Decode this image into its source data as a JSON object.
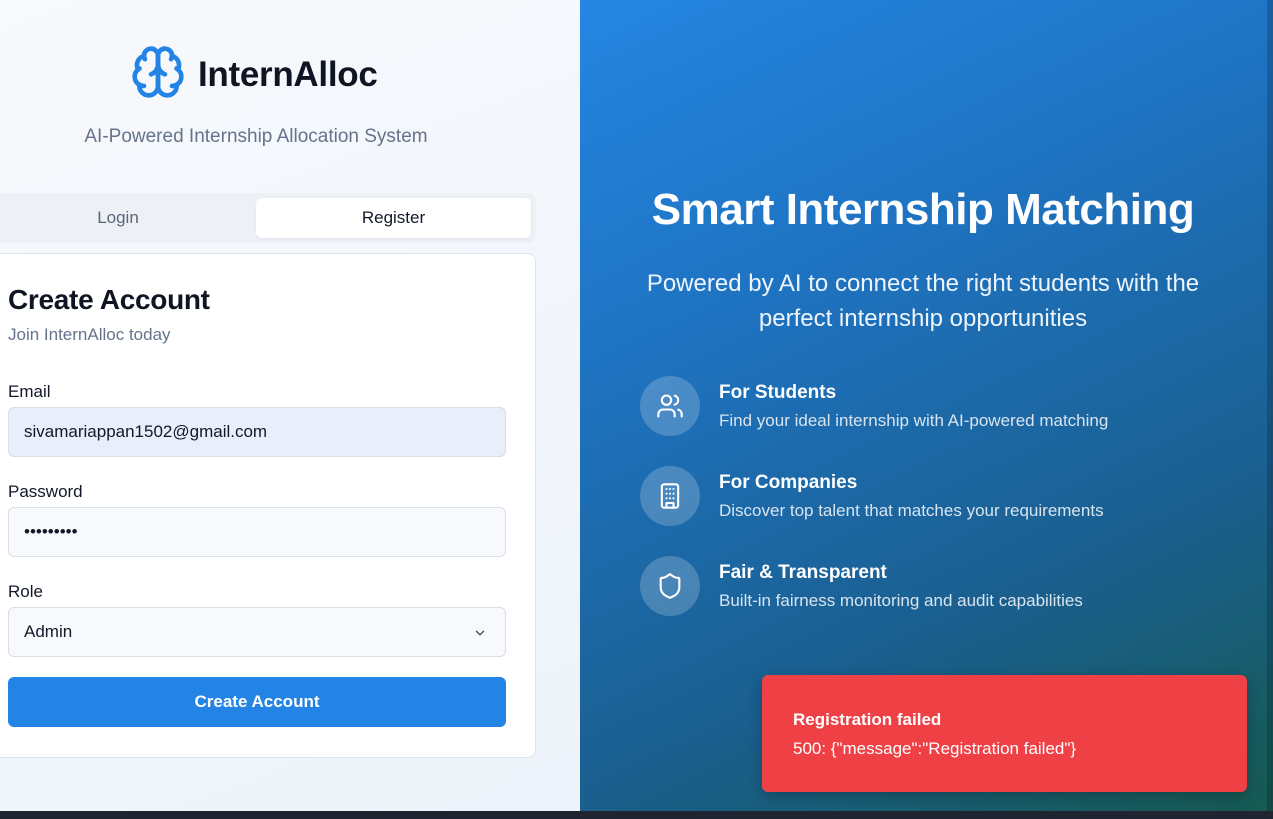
{
  "brand": {
    "name": "InternAlloc",
    "icon": "brain-icon",
    "subtitle": "AI-Powered Internship Allocation System"
  },
  "tabs": [
    {
      "label": "Login",
      "active": false
    },
    {
      "label": "Register",
      "active": true
    }
  ],
  "form": {
    "title": "Create Account",
    "subtitle": "Join InternAlloc today",
    "email": {
      "label": "Email",
      "value": "sivamariappan1502@gmail.com"
    },
    "password": {
      "label": "Password",
      "value": "•••••••••"
    },
    "role": {
      "label": "Role",
      "value": "Admin"
    },
    "submit_label": "Create Account"
  },
  "hero": {
    "title": "Smart Internship Matching",
    "subtitle": "Powered by AI to connect the right students with the perfect internship opportunities",
    "features": [
      {
        "icon": "users-icon",
        "title": "For Students",
        "desc": "Find your ideal internship with AI-powered matching"
      },
      {
        "icon": "building-icon",
        "title": "For Companies",
        "desc": "Discover top talent that matches your requirements"
      },
      {
        "icon": "shield-icon",
        "title": "Fair & Transparent",
        "desc": "Built-in fairness monitoring and audit capabilities"
      }
    ]
  },
  "toast": {
    "title": "Registration failed",
    "message": "500: {\"message\":\"Registration failed\"}"
  },
  "colors": {
    "accent": "#2384e6",
    "error": "#ef4145",
    "hero_start": "#2586e2",
    "hero_end": "#165a52"
  }
}
